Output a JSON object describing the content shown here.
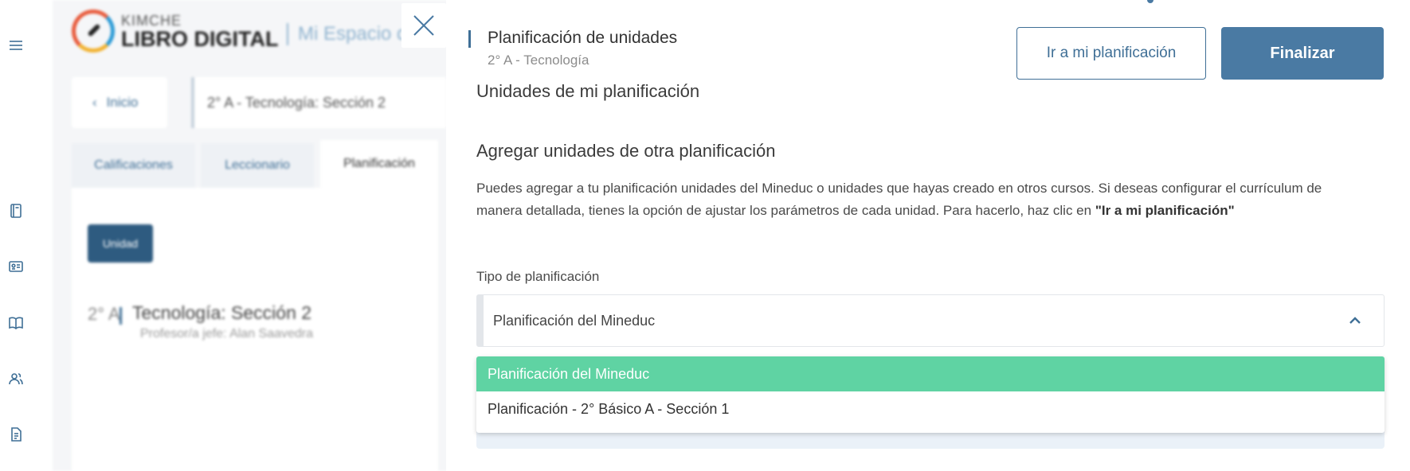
{
  "background": {
    "logo": {
      "kimche": "KIMCHE",
      "libro": "LIBRO DIGITAL",
      "espacio": "Mi Espacio d"
    },
    "breadcrumb": {
      "back_label": "Inicio",
      "course_label": "2° A - Tecnología: Sección 2"
    },
    "tabs": [
      "Calificaciones",
      "Leccionario",
      "Planificación"
    ],
    "unit_button": "Unidad",
    "card": {
      "grade": "2° A",
      "subject": "Tecnología: Sección 2",
      "teacher": "Profesor/a jefe: Alan Saavedra"
    }
  },
  "rail": {
    "icons": [
      "menu-icon",
      "notebook-icon",
      "id-card-icon",
      "book-icon",
      "users-icon",
      "document-icon"
    ]
  },
  "drawer": {
    "title": "Planificación de unidades",
    "subtitle": "2° A - Tecnología",
    "go_to_planning_label": "Ir a mi planificación",
    "finish_label": "Finalizar",
    "my_units_title": "Unidades de mi planificación",
    "add_units_title": "Agregar unidades de otra planificación",
    "description_text": "Puedes agregar a tu planificación unidades del Mineduc o unidades que hayas creado en otros cursos. Si deseas configurar el currículum de manera detallada, tienes la opción de ajustar los parámetros de cada unidad. Para hacerlo, haz clic en ",
    "description_bold": "\"Ir a mi planificación\"",
    "planning_type_label": "Tipo de planificación",
    "selected_value": "Planificación del Mineduc",
    "options": [
      "Planificación del Mineduc",
      "Planificación - 2° Básico A - Sección 1"
    ],
    "accent_color": "#4a7aa3",
    "selected_option_color": "#5fd3a3"
  }
}
